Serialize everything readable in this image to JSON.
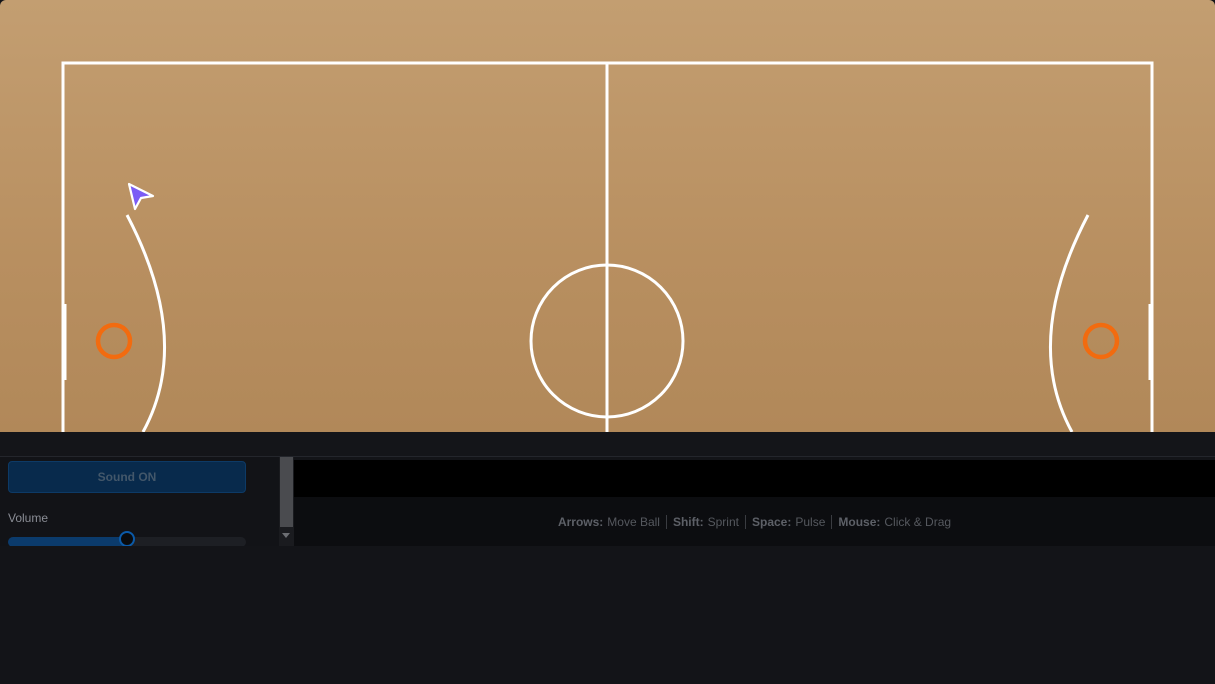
{
  "court": {
    "floor_color": "#bd9768",
    "line_color": "#ffffff",
    "hoop_color": "#f26b0f",
    "elements": [
      "court-boundary",
      "center-line",
      "center-circle",
      "left-three-point-arc",
      "right-three-point-arc",
      "left-backboard",
      "right-backboard",
      "left-hoop",
      "right-hoop"
    ]
  },
  "cursor": {
    "icon": "pointer-arrow-icon",
    "color": "#7b5cf5"
  },
  "controls": {
    "sound_button_label": "Sound ON",
    "volume_label": "Volume",
    "volume_level": 0.5
  },
  "help": {
    "hints": [
      {
        "key": "Arrows:",
        "action": "Move Ball"
      },
      {
        "key": "Shift:",
        "action": "Sprint"
      },
      {
        "key": "Space:",
        "action": "Pulse"
      },
      {
        "key": "Mouse:",
        "action": "Click & Drag"
      }
    ]
  }
}
